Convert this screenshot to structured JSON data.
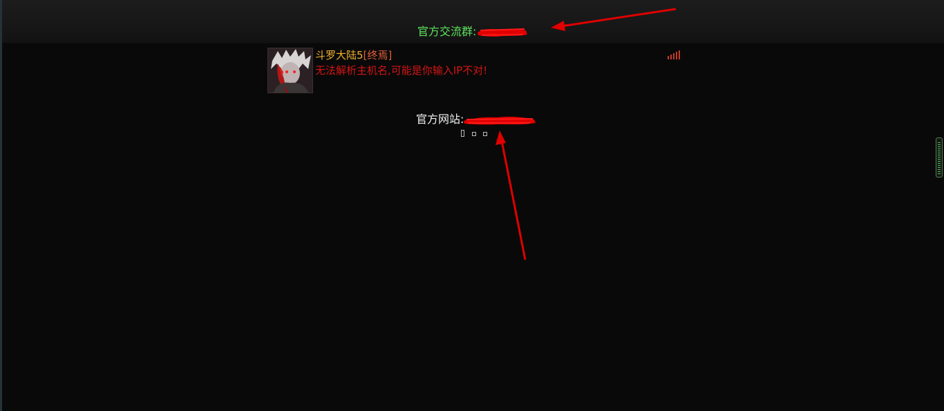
{
  "top_bar": {
    "group_label": "官方交流群:"
  },
  "server": {
    "name": "斗罗大陆5",
    "tag": "[终焉]",
    "status_message": "无法解析主机名,可能是你输入IP不对!"
  },
  "website": {
    "label": "官方网站:"
  },
  "pager": {
    "page_count": 3
  },
  "colors": {
    "background": "#0a0909",
    "group_label": "#5ee25e",
    "server_name": "#f0b030",
    "server_tag": "#e0603a",
    "status_error": "#d21515",
    "annotation_red": "#e00000"
  },
  "icons": {
    "signal": "signal-bars-icon",
    "avatar": "server-avatar"
  }
}
